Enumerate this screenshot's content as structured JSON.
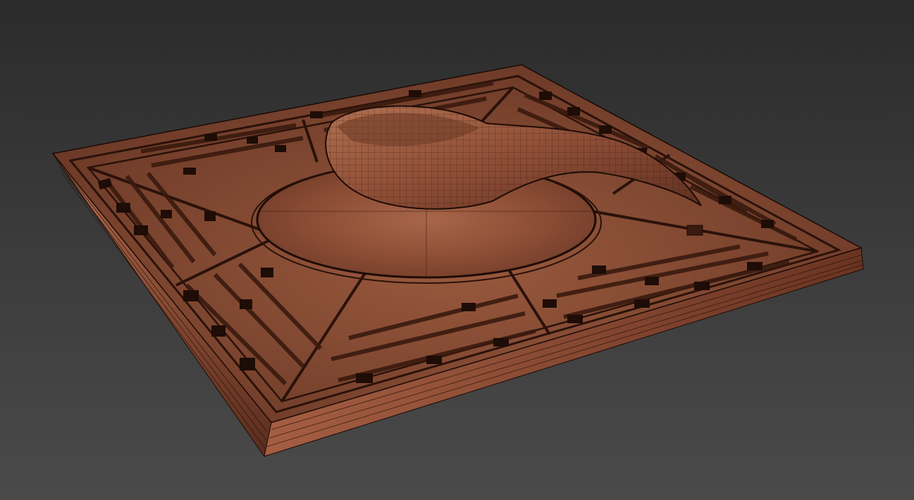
{
  "viewport": {
    "background_top": "#2b2b2b",
    "background_bottom": "#4a4a4a"
  },
  "model": {
    "name": "",
    "material_color": "#8a4a33",
    "material_dark": "#3a1a10",
    "wire_color": "#1a0a05",
    "rim_highlight": "#b86a4a"
  }
}
